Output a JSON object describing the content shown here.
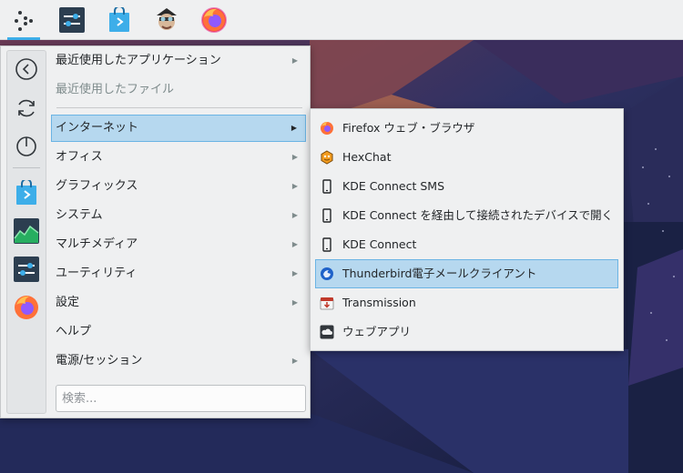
{
  "panel": {
    "icons": [
      "kickoff-launcher-icon",
      "system-settings-icon",
      "discover-store-icon",
      "jester-character-icon",
      "firefox-icon"
    ]
  },
  "menu": {
    "favorites": [
      "back-arrow-icon",
      "refresh-icon",
      "power-icon",
      "discover-store-icon",
      "system-monitor-icon",
      "system-settings-icon",
      "firefox-icon"
    ],
    "items": [
      {
        "label": "最近使用したアプリケーション",
        "arrow": "▶"
      },
      {
        "label": "最近使用したファイル"
      },
      {
        "label": "インターネット",
        "arrow": "▶"
      },
      {
        "label": "オフィス",
        "arrow": "▶"
      },
      {
        "label": "グラフィックス",
        "arrow": "▶"
      },
      {
        "label": "システム",
        "arrow": "▶"
      },
      {
        "label": "マルチメディア",
        "arrow": "▶"
      },
      {
        "label": "ユーティリティ",
        "arrow": "▶"
      },
      {
        "label": "設定",
        "arrow": "▶"
      },
      {
        "label": "ヘルプ"
      },
      {
        "label": "電源/セッション",
        "arrow": "▶"
      }
    ],
    "search_placeholder": "検索..."
  },
  "submenu": {
    "items": [
      {
        "label": "Firefox ウェブ・ブラウザ",
        "icon": "firefox-icon"
      },
      {
        "label": "HexChat",
        "icon": "hexchat-icon"
      },
      {
        "label": "KDE Connect SMS",
        "icon": "phone-icon"
      },
      {
        "label": "KDE Connect を経由して接続されたデバイスで開く",
        "icon": "phone-icon"
      },
      {
        "label": "KDE Connect",
        "icon": "phone-icon"
      },
      {
        "label": "Thunderbird電子メールクライアント",
        "icon": "thunderbird-icon"
      },
      {
        "label": "Transmission",
        "icon": "transmission-icon"
      },
      {
        "label": "ウェブアプリ",
        "icon": "cloud-icon"
      }
    ]
  },
  "colors": {
    "highlight": "#b6d8ef",
    "highlight_border": "#6bb4e4",
    "accent": "#3daee9",
    "panel": "#eff0f1"
  }
}
